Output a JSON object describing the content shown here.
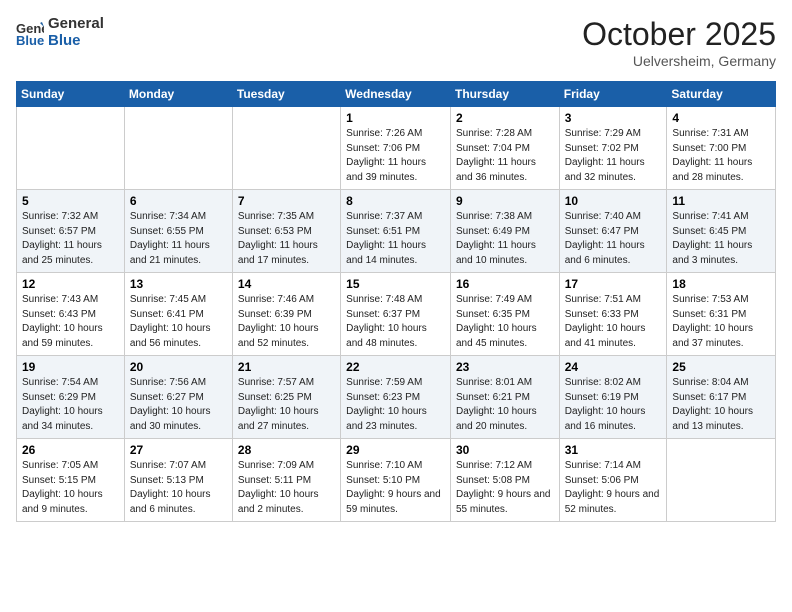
{
  "header": {
    "logo_line1": "General",
    "logo_line2": "Blue",
    "month": "October 2025",
    "location": "Uelversheim, Germany"
  },
  "weekdays": [
    "Sunday",
    "Monday",
    "Tuesday",
    "Wednesday",
    "Thursday",
    "Friday",
    "Saturday"
  ],
  "weeks": [
    [
      {
        "day": "",
        "info": ""
      },
      {
        "day": "",
        "info": ""
      },
      {
        "day": "",
        "info": ""
      },
      {
        "day": "1",
        "info": "Sunrise: 7:26 AM\nSunset: 7:06 PM\nDaylight: 11 hours and 39 minutes."
      },
      {
        "day": "2",
        "info": "Sunrise: 7:28 AM\nSunset: 7:04 PM\nDaylight: 11 hours and 36 minutes."
      },
      {
        "day": "3",
        "info": "Sunrise: 7:29 AM\nSunset: 7:02 PM\nDaylight: 11 hours and 32 minutes."
      },
      {
        "day": "4",
        "info": "Sunrise: 7:31 AM\nSunset: 7:00 PM\nDaylight: 11 hours and 28 minutes."
      }
    ],
    [
      {
        "day": "5",
        "info": "Sunrise: 7:32 AM\nSunset: 6:57 PM\nDaylight: 11 hours and 25 minutes."
      },
      {
        "day": "6",
        "info": "Sunrise: 7:34 AM\nSunset: 6:55 PM\nDaylight: 11 hours and 21 minutes."
      },
      {
        "day": "7",
        "info": "Sunrise: 7:35 AM\nSunset: 6:53 PM\nDaylight: 11 hours and 17 minutes."
      },
      {
        "day": "8",
        "info": "Sunrise: 7:37 AM\nSunset: 6:51 PM\nDaylight: 11 hours and 14 minutes."
      },
      {
        "day": "9",
        "info": "Sunrise: 7:38 AM\nSunset: 6:49 PM\nDaylight: 11 hours and 10 minutes."
      },
      {
        "day": "10",
        "info": "Sunrise: 7:40 AM\nSunset: 6:47 PM\nDaylight: 11 hours and 6 minutes."
      },
      {
        "day": "11",
        "info": "Sunrise: 7:41 AM\nSunset: 6:45 PM\nDaylight: 11 hours and 3 minutes."
      }
    ],
    [
      {
        "day": "12",
        "info": "Sunrise: 7:43 AM\nSunset: 6:43 PM\nDaylight: 10 hours and 59 minutes."
      },
      {
        "day": "13",
        "info": "Sunrise: 7:45 AM\nSunset: 6:41 PM\nDaylight: 10 hours and 56 minutes."
      },
      {
        "day": "14",
        "info": "Sunrise: 7:46 AM\nSunset: 6:39 PM\nDaylight: 10 hours and 52 minutes."
      },
      {
        "day": "15",
        "info": "Sunrise: 7:48 AM\nSunset: 6:37 PM\nDaylight: 10 hours and 48 minutes."
      },
      {
        "day": "16",
        "info": "Sunrise: 7:49 AM\nSunset: 6:35 PM\nDaylight: 10 hours and 45 minutes."
      },
      {
        "day": "17",
        "info": "Sunrise: 7:51 AM\nSunset: 6:33 PM\nDaylight: 10 hours and 41 minutes."
      },
      {
        "day": "18",
        "info": "Sunrise: 7:53 AM\nSunset: 6:31 PM\nDaylight: 10 hours and 37 minutes."
      }
    ],
    [
      {
        "day": "19",
        "info": "Sunrise: 7:54 AM\nSunset: 6:29 PM\nDaylight: 10 hours and 34 minutes."
      },
      {
        "day": "20",
        "info": "Sunrise: 7:56 AM\nSunset: 6:27 PM\nDaylight: 10 hours and 30 minutes."
      },
      {
        "day": "21",
        "info": "Sunrise: 7:57 AM\nSunset: 6:25 PM\nDaylight: 10 hours and 27 minutes."
      },
      {
        "day": "22",
        "info": "Sunrise: 7:59 AM\nSunset: 6:23 PM\nDaylight: 10 hours and 23 minutes."
      },
      {
        "day": "23",
        "info": "Sunrise: 8:01 AM\nSunset: 6:21 PM\nDaylight: 10 hours and 20 minutes."
      },
      {
        "day": "24",
        "info": "Sunrise: 8:02 AM\nSunset: 6:19 PM\nDaylight: 10 hours and 16 minutes."
      },
      {
        "day": "25",
        "info": "Sunrise: 8:04 AM\nSunset: 6:17 PM\nDaylight: 10 hours and 13 minutes."
      }
    ],
    [
      {
        "day": "26",
        "info": "Sunrise: 7:05 AM\nSunset: 5:15 PM\nDaylight: 10 hours and 9 minutes."
      },
      {
        "day": "27",
        "info": "Sunrise: 7:07 AM\nSunset: 5:13 PM\nDaylight: 10 hours and 6 minutes."
      },
      {
        "day": "28",
        "info": "Sunrise: 7:09 AM\nSunset: 5:11 PM\nDaylight: 10 hours and 2 minutes."
      },
      {
        "day": "29",
        "info": "Sunrise: 7:10 AM\nSunset: 5:10 PM\nDaylight: 9 hours and 59 minutes."
      },
      {
        "day": "30",
        "info": "Sunrise: 7:12 AM\nSunset: 5:08 PM\nDaylight: 9 hours and 55 minutes."
      },
      {
        "day": "31",
        "info": "Sunrise: 7:14 AM\nSunset: 5:06 PM\nDaylight: 9 hours and 52 minutes."
      },
      {
        "day": "",
        "info": ""
      }
    ]
  ]
}
